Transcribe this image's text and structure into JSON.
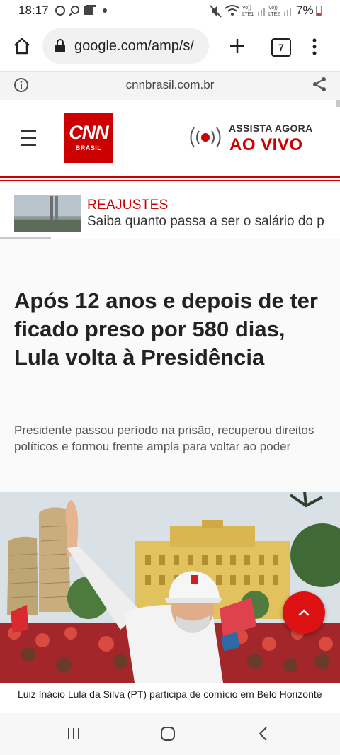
{
  "status_bar": {
    "time": "18:17",
    "battery_percent": "7%",
    "battery_level": 0.07,
    "icons": [
      "b-badge-icon",
      "chat-search-icon",
      "image-icon",
      "mute-icon",
      "wifi-icon",
      "signal-lte1-icon",
      "signal-lte2-icon",
      "battery-icon"
    ]
  },
  "browser": {
    "url": "google.com/amp/s/",
    "tab_count": "7",
    "amp_domain": "cnnbrasil.com.br"
  },
  "header": {
    "logo_text": "CNN",
    "logo_subtext": "BRASIL",
    "live_title": "ASSISTA AGORA",
    "live_subtitle": "AO VIVO"
  },
  "ticker": {
    "label": "REAJUSTES",
    "text": "Saiba quanto passa a ser o salário do p"
  },
  "article": {
    "headline": "Após 12 anos e depois de ter ficado preso por 580 dias, Lula volta à Presidência",
    "subtitle": "Presidente passou período na prisão, recuperou direitos políticos e formou frente ampla para voltar ao poder",
    "photo_caption": "Luiz Inácio Lula da Silva (PT) participa de comício em Belo Horizonte"
  },
  "colors": {
    "cnn_red": "#cc0000",
    "fab_red": "#dd1111"
  }
}
